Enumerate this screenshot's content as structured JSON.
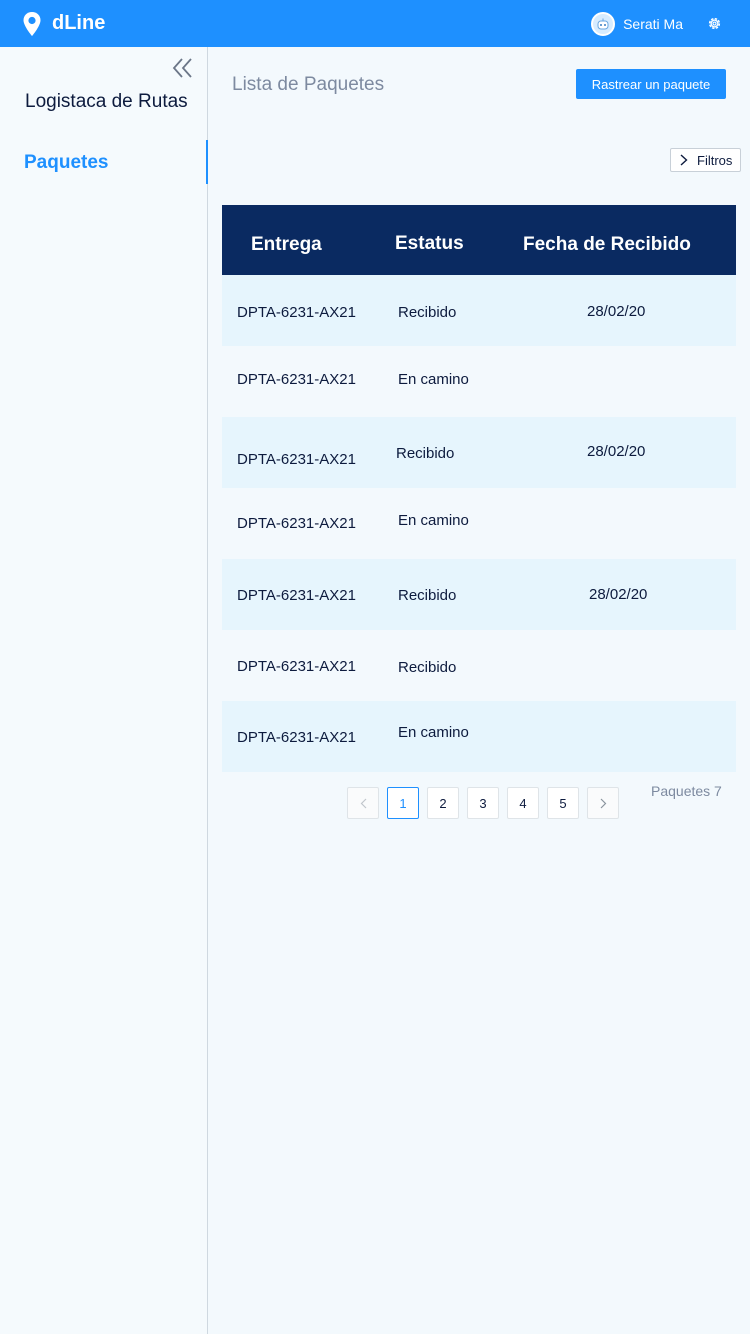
{
  "app": {
    "name": "dLine"
  },
  "user": {
    "name": "Serati Ma"
  },
  "sidebar": {
    "title": "Logistaca de Rutas",
    "items": [
      {
        "label": "Paquetes",
        "active": true
      }
    ]
  },
  "header": {
    "title": "Lista de Paquetes",
    "track_button": "Rastrear un paquete",
    "filters_button": "Filtros"
  },
  "table": {
    "columns": [
      "Entrega",
      "Estatus",
      "Fecha de Recibido"
    ],
    "rows": [
      {
        "entrega": "DPTA-6231-AX21",
        "estatus": "Recibido",
        "fecha": "28/02/20"
      },
      {
        "entrega": "DPTA-6231-AX21",
        "estatus": "En camino",
        "fecha": ""
      },
      {
        "entrega": "DPTA-6231-AX21",
        "estatus": "Recibido",
        "fecha": "28/02/20"
      },
      {
        "entrega": "DPTA-6231-AX21",
        "estatus": "En camino",
        "fecha": ""
      },
      {
        "entrega": "DPTA-6231-AX21",
        "estatus": "Recibido",
        "fecha": "28/02/20"
      },
      {
        "entrega": "DPTA-6231-AX21",
        "estatus": "Recibido",
        "fecha": ""
      },
      {
        "entrega": "DPTA-6231-AX21",
        "estatus": "En camino",
        "fecha": ""
      }
    ]
  },
  "pagination": {
    "pages": [
      "1",
      "2",
      "3",
      "4",
      "5"
    ],
    "current": "1",
    "total_label": "Paquetes 7"
  },
  "colors": {
    "primary": "#1e90ff",
    "header_dark": "#0a2a61",
    "row_alt": "#e6f5fd"
  }
}
